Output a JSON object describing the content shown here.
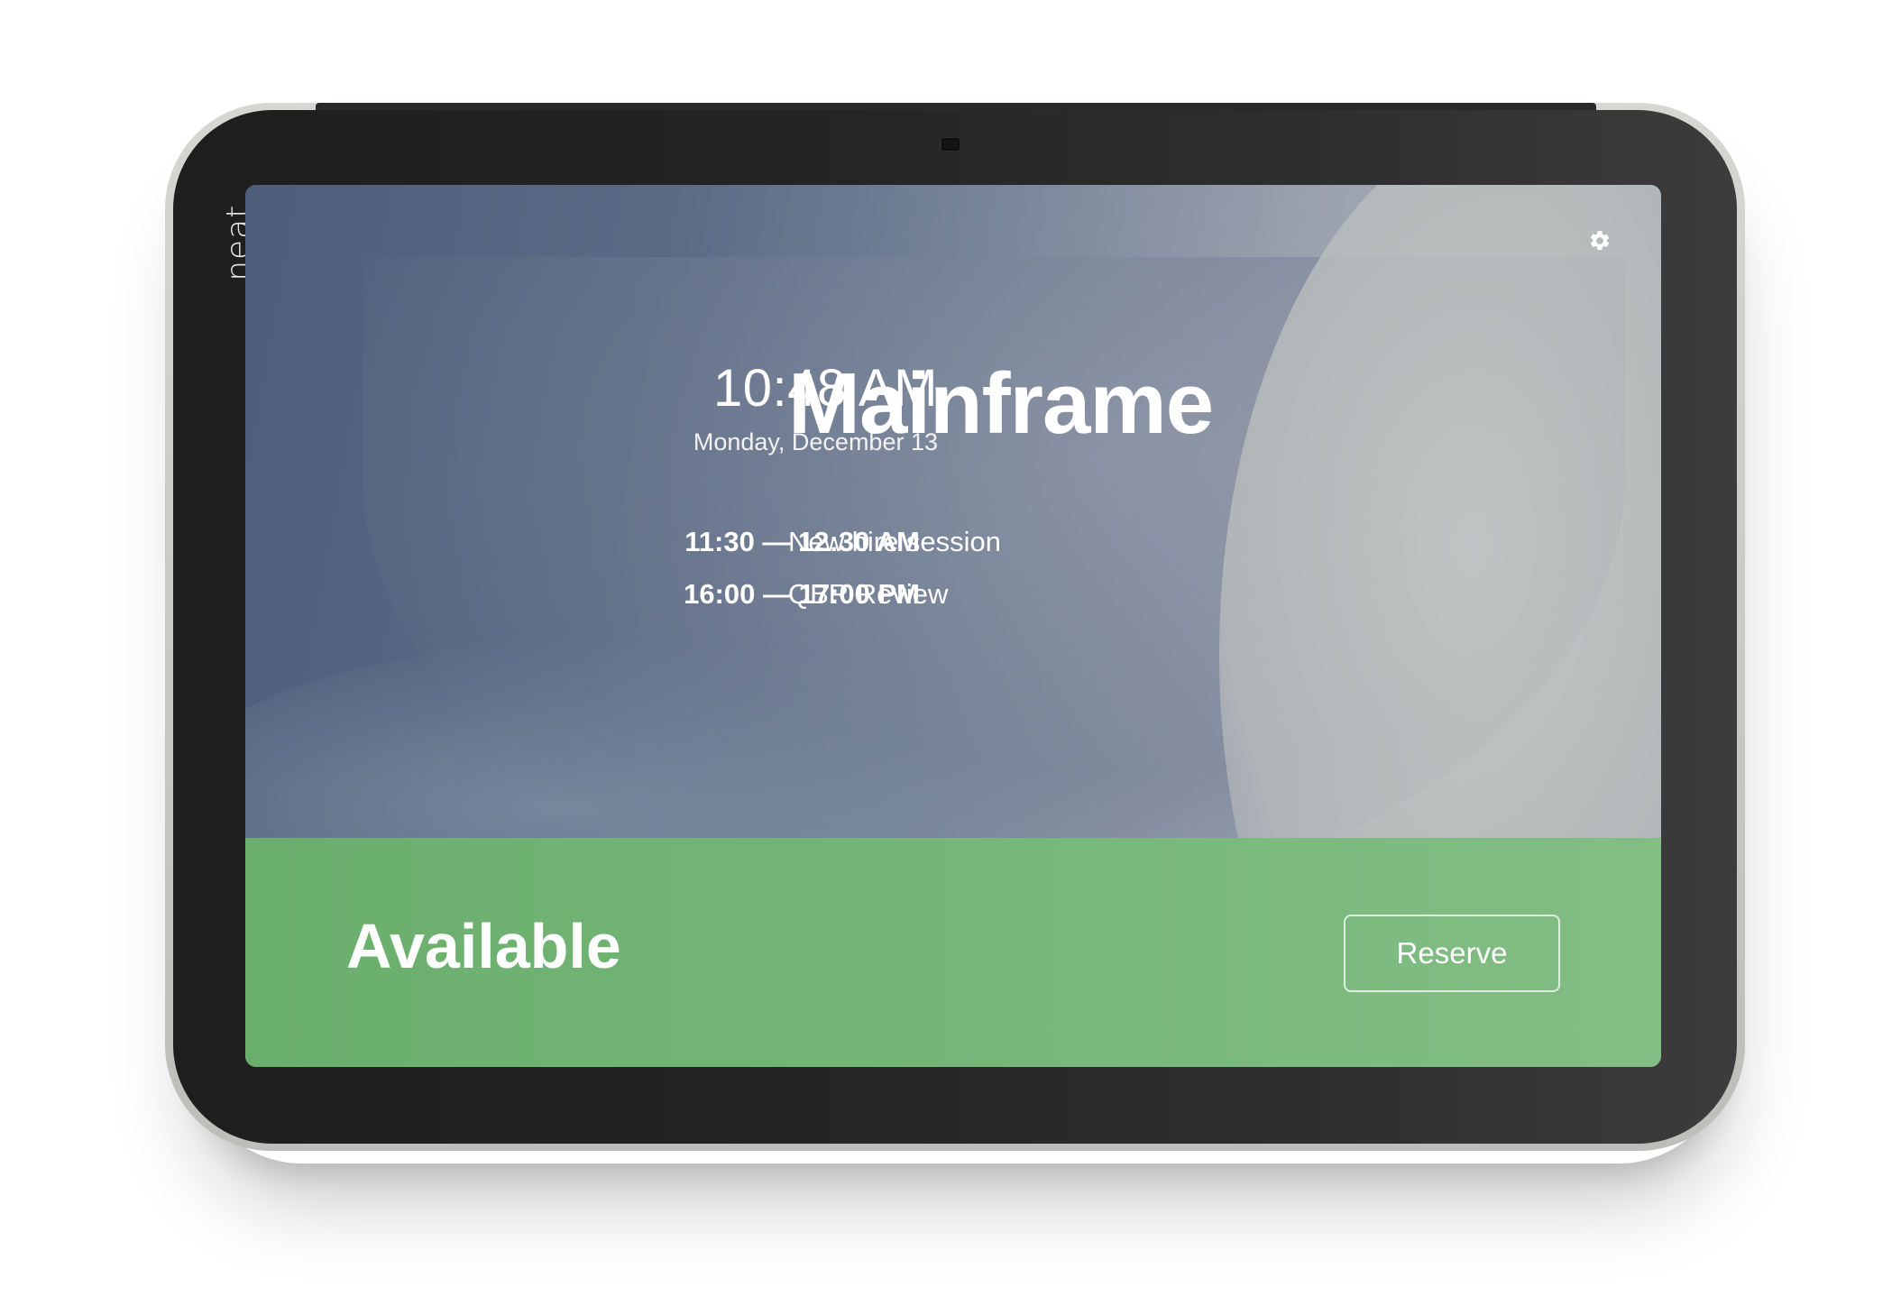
{
  "device": {
    "brand": "neat.",
    "colors": {
      "bezel": "#242424",
      "frame": "#cfcfcc"
    }
  },
  "header": {
    "settings_icon": "gear-icon"
  },
  "clock": {
    "time": "10:48 AM",
    "date": "Monday, December 13"
  },
  "room": {
    "name": "Mainframe"
  },
  "meetings": [
    {
      "time": "11:30 — 12:30 AM",
      "title": "New hire session"
    },
    {
      "time": "16:00 — 17:00 PM",
      "title": "QBR Review"
    }
  ],
  "status": {
    "label": "Available",
    "reserve_label": "Reserve",
    "color": "#73b575"
  }
}
